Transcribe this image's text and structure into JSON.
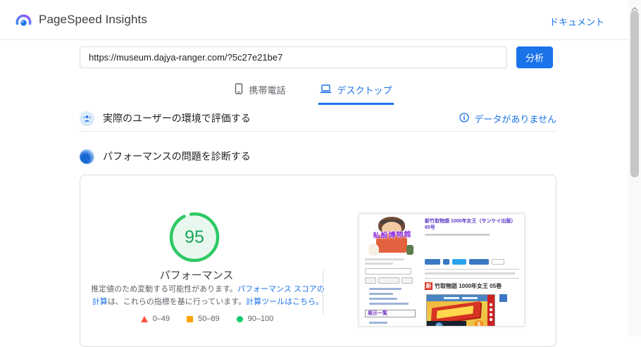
{
  "app": {
    "title": "PageSpeed Insights",
    "docs_link": "ドキュメント"
  },
  "url_bar": {
    "url": "https://museum.dajya-ranger.com/?5c27e21be7",
    "analyze_button": "分析"
  },
  "tabs": {
    "mobile": "携帯電話",
    "desktop": "デスクトップ",
    "active": "デスクトップ"
  },
  "field_section": {
    "title": "実際のユーザーの環境で評価する",
    "no_data_label": "データがありません"
  },
  "lab_section": {
    "title": "パフォーマンスの問題を診断する"
  },
  "performance_report": {
    "score": "95",
    "label": "パフォーマンス",
    "disclaimer": {
      "part1": "推定値のため変動する可能性があります。",
      "link1": "パフォーマンス スコアの計算",
      "part2": "は、これらの指標を基に行っています。",
      "link2": "計算ツールはこちら。"
    },
    "legend": [
      {
        "marker": "triangle",
        "color": "#ff4e42",
        "range": "0–49"
      },
      {
        "marker": "square",
        "color": "#ffa400",
        "range": "50–89"
      },
      {
        "marker": "circle",
        "color": "#0cce6b",
        "range": "90–100"
      }
    ]
  },
  "screenshot_preview": {
    "site_name": "私設博物館",
    "page_title": "新竹取物語 1000年女王（サンケイ出版）65号",
    "sidebar_box": "展示一覧",
    "new_badge": "新",
    "article_title": "竹取物語 1000年女王 05巻"
  },
  "colors": {
    "accent_blue": "#1a73e8",
    "score_green": "#0cce6b",
    "fail_red": "#ff4e42",
    "average_orange": "#ffa400"
  }
}
